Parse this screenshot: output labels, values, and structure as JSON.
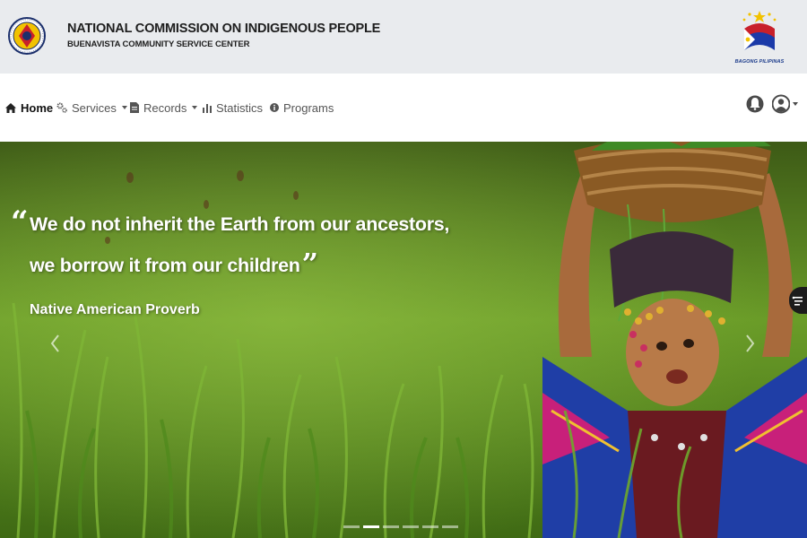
{
  "header": {
    "org_name": "NATIONAL COMMISSION ON INDIGENOUS PEOPLE",
    "center_name": "BUENAVISTA COMMUNITY SERVICE CENTER",
    "left_logo_icon": "ncip-seal-icon",
    "right_logo_icon": "bagong-pilipinas-logo-icon",
    "right_logo_caption": "BAGONG PILIPINAS"
  },
  "nav": {
    "items": [
      {
        "label": "Home",
        "icon": "home-icon",
        "active": true,
        "dropdown": false
      },
      {
        "label": "Services",
        "icon": "gears-icon",
        "active": false,
        "dropdown": true
      },
      {
        "label": "Records",
        "icon": "file-icon",
        "active": false,
        "dropdown": true
      },
      {
        "label": "Statistics",
        "icon": "bar-chart-icon",
        "active": false,
        "dropdown": false
      },
      {
        "label": "Programs",
        "icon": "info-circle-icon",
        "active": false,
        "dropdown": false
      }
    ],
    "notification_icon": "bell-icon",
    "user_icon": "user-circle-icon"
  },
  "hero": {
    "quote_line1": "We do not inherit the Earth from our ancestors,",
    "quote_line2": "we borrow it from our children",
    "attribution": "Native American Proverb",
    "slide_count": 6,
    "active_slide": 2
  },
  "colors": {
    "header_bg": "#e9ebee",
    "nav_text": "#555555",
    "nav_active": "#111111",
    "hero_green": "#5c8a24"
  }
}
